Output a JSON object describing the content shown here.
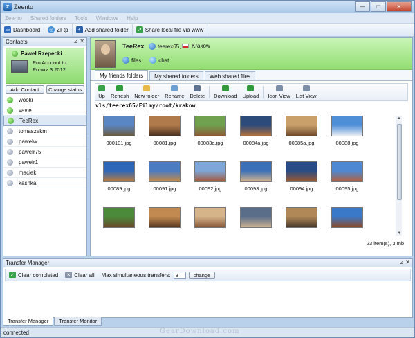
{
  "window": {
    "title": "Zeento",
    "minimize": "—",
    "maximize": "□",
    "close": "✕"
  },
  "menu": [
    "Zeento",
    "Shared folders",
    "Tools",
    "Windows",
    "Help"
  ],
  "toolbar": [
    {
      "label": "Dashboard",
      "icon": "dashboard-icon",
      "color": "#2d6cc0"
    },
    {
      "label": "ZFtp",
      "icon": "globe-icon",
      "color": "#3f8fd8"
    },
    {
      "label": "Add shared folder",
      "icon": "add-folder-icon",
      "color": "#2b5fa6"
    },
    {
      "label": "Share local file via www",
      "icon": "share-icon",
      "color": "#3aa14b"
    }
  ],
  "contacts": {
    "header": "Contacts",
    "pin": "⊿ ✕",
    "me": {
      "name": "Pawel Rzepecki",
      "pro_line1": "Pro Account to:",
      "pro_line2": "Pn wrz 3 2012"
    },
    "add_contact": "Add Contact",
    "change_status": "Change status",
    "list": [
      {
        "name": "wooki",
        "online": true
      },
      {
        "name": "vavie",
        "online": true
      },
      {
        "name": "TeeRex",
        "online": true,
        "selected": true
      },
      {
        "name": "tomaszekm",
        "online": false
      },
      {
        "name": "pawelw",
        "online": false
      },
      {
        "name": "pawelr75",
        "online": false
      },
      {
        "name": "pawelr1",
        "online": false
      },
      {
        "name": "maciek",
        "online": false
      },
      {
        "name": "kashka",
        "online": false
      }
    ]
  },
  "peer": {
    "name": "TeeRex",
    "username": "teerex65,",
    "city": "Kraków",
    "files": "files",
    "chat": "chat"
  },
  "tabs": [
    "My friends folders",
    "My shared folders",
    "Web shared files"
  ],
  "file_toolbar": [
    {
      "label": "Up",
      "color": "#3aa14b"
    },
    {
      "label": "Refresh",
      "color": "#2e9c3a"
    },
    {
      "label": "New folder",
      "color": "#e8b84a"
    },
    {
      "label": "Rename",
      "color": "#6aa0d6"
    },
    {
      "label": "Delete",
      "color": "#5f7391"
    },
    {
      "label": "Download",
      "color": "#2f9a3a"
    },
    {
      "label": "Upload",
      "color": "#2f9a3a"
    },
    {
      "label": "Icon View",
      "color": "#7c8ea6"
    },
    {
      "label": "List View",
      "color": "#7c8ea6"
    }
  ],
  "path": "vls/teerex65/Filmy/root/krakow",
  "files": [
    {
      "name": "000101.jpg",
      "c1": "#5a86c4",
      "c2": "#6b5b3e"
    },
    {
      "name": "00081.jpg",
      "c1": "#b07a4a",
      "c2": "#4a3020"
    },
    {
      "name": "00083a.jpg",
      "c1": "#6fa14e",
      "c2": "#8c5a36"
    },
    {
      "name": "00084a.jpg",
      "c1": "#2c4a7a",
      "c2": "#b0703c"
    },
    {
      "name": "00085a.jpg",
      "c1": "#c9a06a",
      "c2": "#6e4a2c"
    },
    {
      "name": "00088.jpg",
      "c1": "#4f8fd8",
      "c2": "#e8eef6"
    },
    {
      "name": "00089.jpg",
      "c1": "#2f67b8",
      "c2": "#b87a3e"
    },
    {
      "name": "00091.jpg",
      "c1": "#4b7bc0",
      "c2": "#c58a4a"
    },
    {
      "name": "00092.jpg",
      "c1": "#7ea6d8",
      "c2": "#a45a3a"
    },
    {
      "name": "00093.jpg",
      "c1": "#3b6fb8",
      "c2": "#d2b48c"
    },
    {
      "name": "00094.jpg",
      "c1": "#2a4c86",
      "c2": "#9a5a30"
    },
    {
      "name": "00095.jpg",
      "c1": "#4e88d2",
      "c2": "#b06040"
    },
    {
      "name": "",
      "c1": "#4a8a3a",
      "c2": "#6a4a2a"
    },
    {
      "name": "",
      "c1": "#c28a50",
      "c2": "#5a3a22"
    },
    {
      "name": "",
      "c1": "#d6b48a",
      "c2": "#8a5a3a"
    },
    {
      "name": "",
      "c1": "#5a6e8a",
      "c2": "#c8b090"
    },
    {
      "name": "",
      "c1": "#b08858",
      "c2": "#4a3a2a"
    },
    {
      "name": "",
      "c1": "#3a78c8",
      "c2": "#8a4a2a"
    }
  ],
  "item_count": "23 item(s), 3 mb",
  "transfer": {
    "header": "Transfer Manager",
    "pin": "⊿ ✕",
    "clear_completed": "Clear completed",
    "clear_all": "Clear all",
    "max_label": "Max simultaneous transfers:",
    "max_value": "3",
    "change": "change"
  },
  "bottom_tabs": [
    "Transfer Manager",
    "Transfer Monitor"
  ],
  "status": "connected",
  "watermark": "GearDownload.com"
}
